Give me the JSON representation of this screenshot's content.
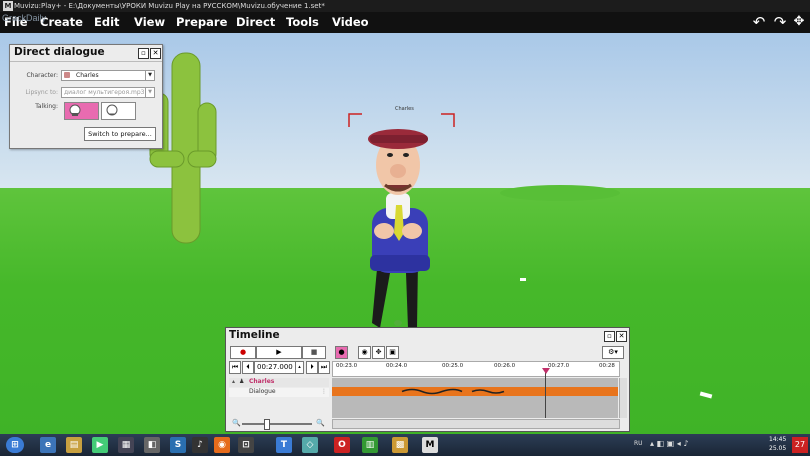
{
  "window": {
    "title": "Muvizu:Play+ - E:\\Документы\\УРОКИ Muvizu Play на РУССКОМ\\Muvizu.обучение 1.set*",
    "logo_text": "M",
    "watermark": "GrackDaily"
  },
  "menu": [
    "File",
    "Create",
    "Edit",
    "View",
    "Prepare",
    "Direct",
    "Tools",
    "Video"
  ],
  "toolbar": {
    "undo_icon": "undo-icon",
    "redo_icon": "redo-icon"
  },
  "scene": {
    "character_label": "Charles",
    "colors": {
      "sky": "#b6d0e8",
      "ground": "#4cbb2d",
      "cactus": "#8cc63f"
    }
  },
  "direct_dialogue": {
    "title": "Direct dialogue",
    "character_label": "Character:",
    "character_value": "Charles",
    "lipsync_label": "Lipsync to:",
    "lipsync_value": "диалог мультигероя.mp3",
    "talking_label": "Talking:",
    "switch_button": "Switch to prepare..."
  },
  "timeline": {
    "title": "Timeline",
    "time_value": "00:27.000",
    "ticks": [
      "00:23.0",
      "00:24.0",
      "00:25.0",
      "00:26.0",
      "00:27.0",
      "00:28"
    ],
    "tracks": [
      {
        "name": "Charles",
        "color": "#c0306a"
      },
      {
        "name": "Dialogue",
        "color": "#333333"
      }
    ],
    "clip_color": "#e8741c",
    "playhead_color": "#c0306a"
  },
  "taskbar": {
    "lang": "RU",
    "time": "14:45",
    "date": "25.05",
    "clock_badge": "27"
  }
}
